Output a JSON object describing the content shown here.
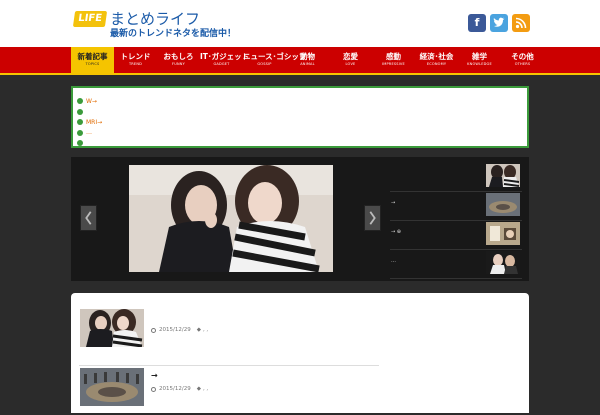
{
  "header": {
    "logo_badge": "LIFE",
    "title": "まとめライフ",
    "subtitle": "最新のトレンドネタを配信中！",
    "social": {
      "facebook": "f",
      "twitter": "t",
      "rss": "RSS"
    }
  },
  "nav": {
    "items": [
      {
        "label": "新着記事",
        "sub": "TOPICS",
        "active": true
      },
      {
        "label": "トレンド",
        "sub": "TREND"
      },
      {
        "label": "おもしろ",
        "sub": "FUNNY"
      },
      {
        "label": "IT･ガジェット",
        "sub": "GADGET"
      },
      {
        "label": "ニュース･ゴシップ",
        "sub": "GOSSIP"
      },
      {
        "label": "動物",
        "sub": "ANIMAL"
      },
      {
        "label": "恋愛",
        "sub": "LOVE"
      },
      {
        "label": "感動",
        "sub": "IMPRESSIVE"
      },
      {
        "label": "経済･社会",
        "sub": "ECONOMY"
      },
      {
        "label": "雑学",
        "sub": "KNOWLEDGE"
      },
      {
        "label": "その他",
        "sub": "OTHERS"
      }
    ]
  },
  "topics": {
    "items": [
      "W→",
      "",
      "MRI→",
      "…",
      ""
    ]
  },
  "slider": {
    "thumbs": [
      {
        "text": ""
      },
      {
        "text": "→"
      },
      {
        "text": "→ ⊕"
      },
      {
        "text": "…"
      }
    ]
  },
  "articles": [
    {
      "title": "",
      "date": "2015/12/29",
      "tags": ", ,"
    },
    {
      "title": "→",
      "date": "2015/12/29",
      "tags": ", ,"
    }
  ],
  "colors": {
    "nav_red": "#cc0000",
    "nav_active": "#f5c400",
    "topic_border": "#3b9b3b",
    "brand_blue": "#1a5aa8"
  }
}
